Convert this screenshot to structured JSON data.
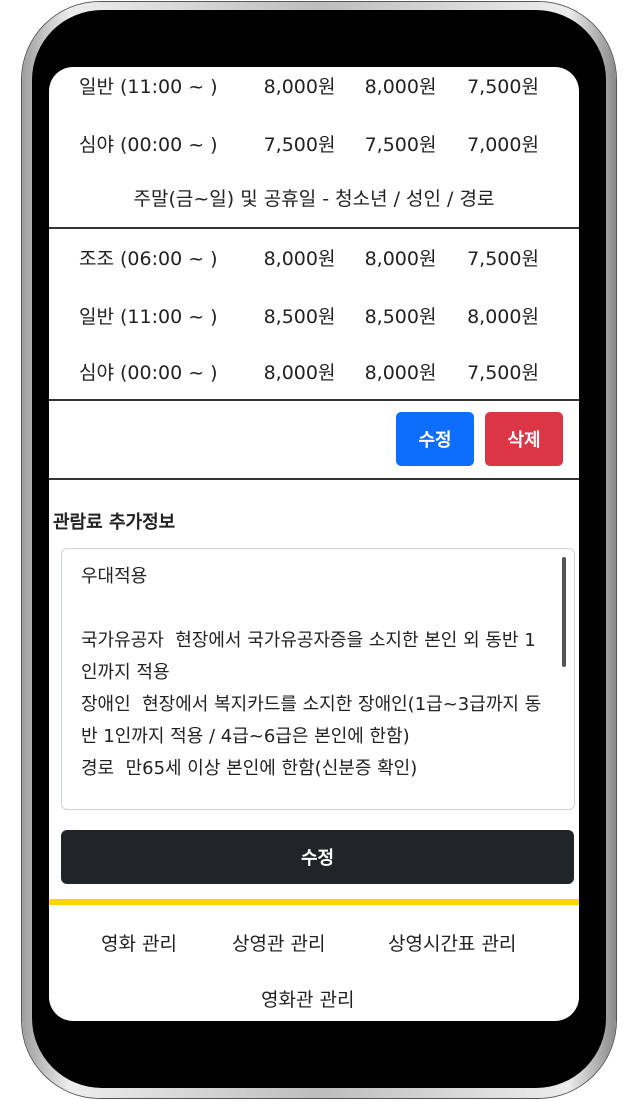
{
  "table": {
    "top_partial": {
      "slot": "일반 (11:00 ~ )",
      "p1": "8,000원",
      "p2": "8,000원",
      "p3": "7,500원"
    },
    "top_late": {
      "slot": "심야 (00:00 ~ )",
      "p1": "7,500원",
      "p2": "7,500원",
      "p3": "7,000원"
    },
    "weekend_title": "주말(금~일) 및 공휴일 - 청소년 / 성인 / 경로",
    "weekend_rows": [
      {
        "slot": "조조 (06:00 ~ )",
        "p1": "8,000원",
        "p2": "8,000원",
        "p3": "7,500원"
      },
      {
        "slot": "일반 (11:00 ~ )",
        "p1": "8,500원",
        "p2": "8,500원",
        "p3": "8,000원"
      },
      {
        "slot": "심야 (00:00 ~ )",
        "p1": "8,000원",
        "p2": "8,000원",
        "p3": "7,500원"
      }
    ]
  },
  "actions": {
    "edit_label": "수정",
    "delete_label": "삭제"
  },
  "info": {
    "title": "관람료 추가정보",
    "content": "우대적용\n\n국가유공자  현장에서 국가유공자증을 소지한 본인 외 동반 1인까지 적용\n장애인  현장에서 복지카드를 소지한 장애인(1급~3급까지 동반 1인까지 적용 / 4급~6급은 본인에 한함)\n경로  만65세 이상 본인에 한함(신분증 확인)"
  },
  "save_label": "수정",
  "colors": {
    "primary": "#0d6efd",
    "danger": "#dc3545",
    "dark": "#212529",
    "accent": "#ffd400"
  },
  "nav": {
    "movie": "영화 관리",
    "screen": "상영관 관리",
    "schedule": "상영시간표 관리",
    "theater": "영화관 관리"
  }
}
